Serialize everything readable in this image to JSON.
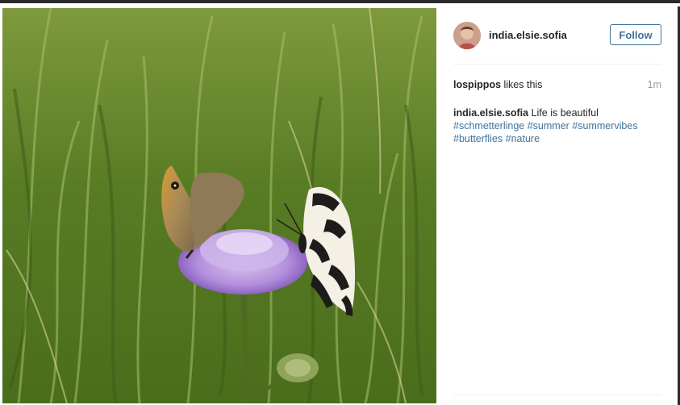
{
  "post": {
    "author": "india.elsie.sofia",
    "follow_label": "Follow",
    "likes": {
      "liker": "lospippos",
      "suffix": " likes this"
    },
    "timestamp": "1m",
    "caption": {
      "author": "india.elsie.sofia",
      "text": " Life is beautiful",
      "hashtags": [
        "#schmetterlinge",
        "#summer",
        "#summervibes",
        "#butterflies",
        "#nature"
      ]
    }
  },
  "colors": {
    "link": "#3f729b",
    "text": "#262626",
    "muted": "#999999"
  },
  "icons": {
    "avatar": "avatar-image"
  }
}
